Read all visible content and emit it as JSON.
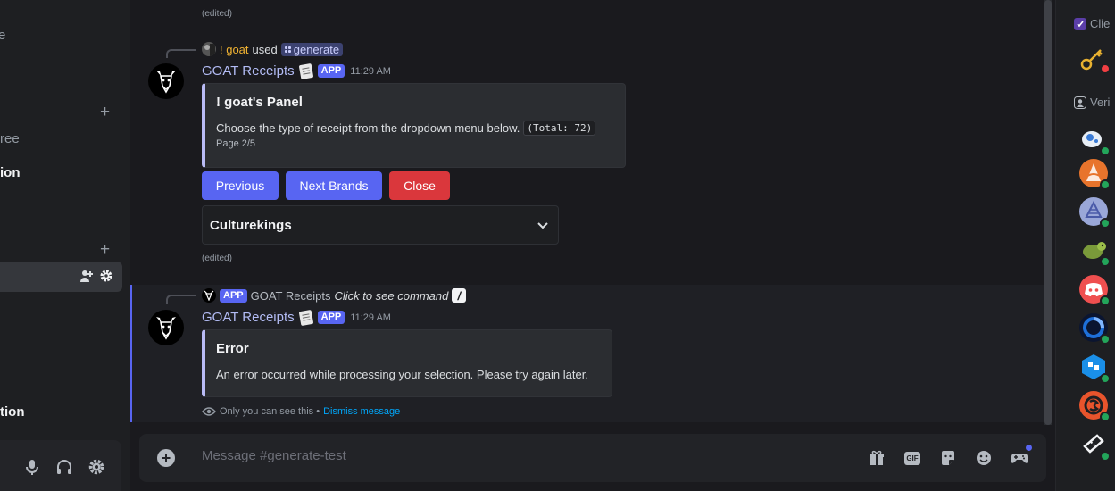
{
  "sidebar": {
    "fragments": [
      "e",
      "ree",
      "ion",
      "tion"
    ],
    "plus": "+"
  },
  "message1": {
    "edited_top": "(edited)",
    "reply": {
      "user": "! goat",
      "used": "used",
      "command": "generate"
    },
    "author": "GOAT Receipts",
    "app_tag": "APP",
    "time": "11:29 AM",
    "embed": {
      "title": "! goat's Panel",
      "description": "Choose the type of receipt from the dropdown menu below.",
      "code": "(Total: 72)",
      "footer": "Page 2/5"
    },
    "buttons": {
      "previous": "Previous",
      "next": "Next Brands",
      "close": "Close"
    },
    "select_value": "Culturekings",
    "edited": "(edited)"
  },
  "message2": {
    "reply": {
      "app_tag": "APP",
      "name": "GOAT Receipts",
      "action": "Click to see command"
    },
    "author": "GOAT Receipts",
    "app_tag": "APP",
    "time": "11:29 AM",
    "embed": {
      "title": "Error",
      "description": "An error occurred while processing your selection. Please try again later."
    },
    "ephemeral": {
      "text": "Only you can see this •",
      "dismiss": "Dismiss message"
    }
  },
  "composer": {
    "placeholder": "Message #generate-test",
    "gif_label": "GIF"
  },
  "members": {
    "client_header": "Clie",
    "verified_header": "Veri"
  },
  "colors": {
    "accent": "#5865f2",
    "danger": "#da373c",
    "online": "#23a55a",
    "mention": "#f0b232"
  }
}
